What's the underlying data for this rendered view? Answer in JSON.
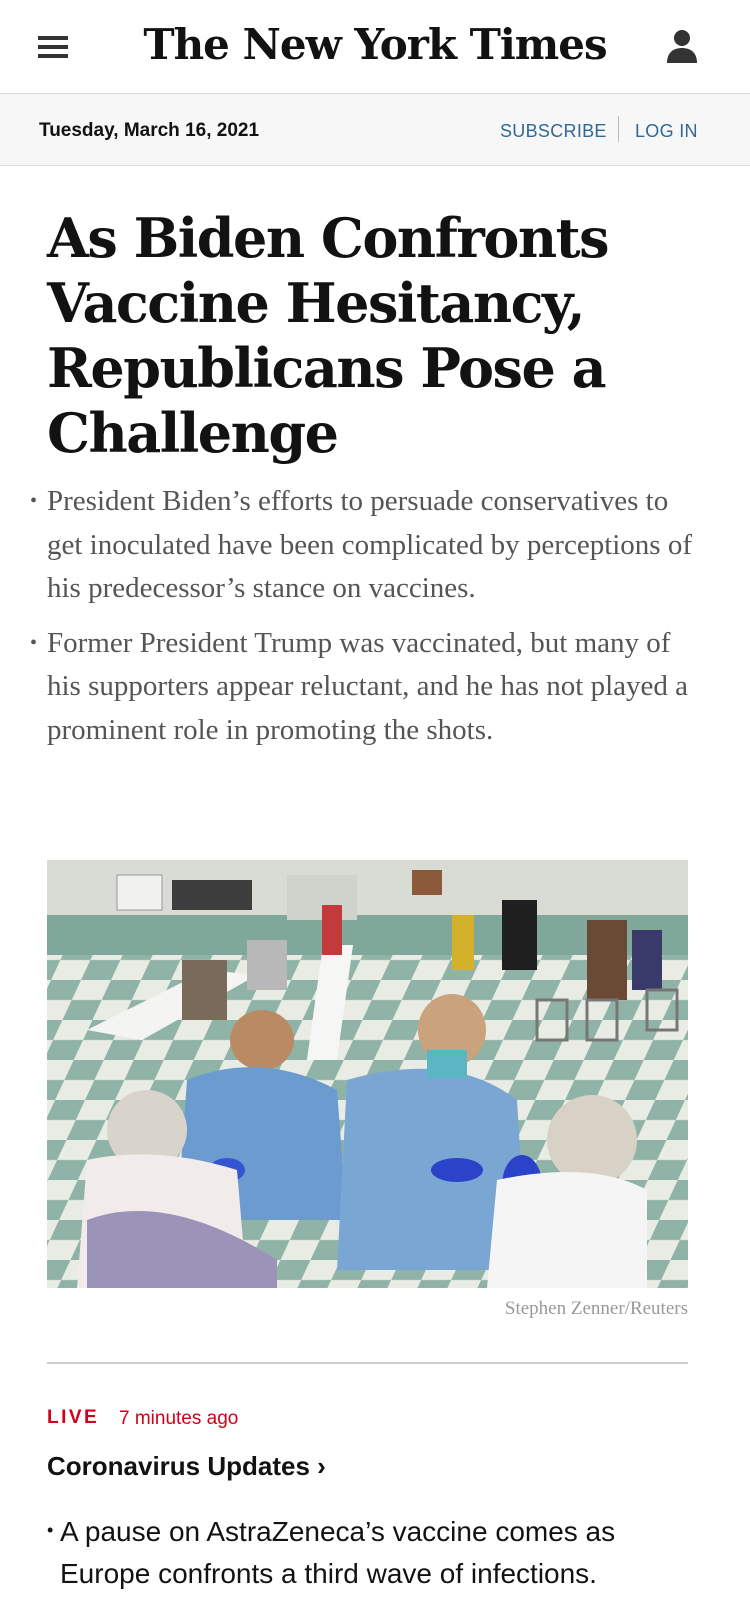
{
  "masthead": {
    "logo": "The New York Times",
    "menu_icon": "hamburger-menu-icon",
    "account_icon": "account-person-icon"
  },
  "datebar": {
    "date": "Tuesday, March 16, 2021",
    "subscribe_label": "SUBSCRIBE",
    "login_label": "LOG IN"
  },
  "article": {
    "headline": "As Biden Confronts Vaccine Hesitancy, Republicans Pose a Challenge",
    "summary": [
      "President Biden’s efforts to persuade conservatives to get inoculated have been complicated by perceptions of his predecessor’s stance on vaccines.",
      "Former President Trump was vaccinated, but many of his supporters appear reluctant, and he has not played a prominent role in promoting the shots."
    ],
    "photo_credit": "Stephen Zenner/Reuters"
  },
  "live_block": {
    "live_label": "LIVE",
    "time_ago": "7 minutes ago",
    "title": "Coronavirus Updates ›",
    "bullets": [
      "A pause on AstraZeneca’s vaccine comes as Europe confronts a third wave of infections."
    ]
  },
  "colors": {
    "link_blue": "#326891",
    "live_red": "#d0021b",
    "summary_gray": "#555555",
    "datebar_bg": "#f7f7f7"
  }
}
